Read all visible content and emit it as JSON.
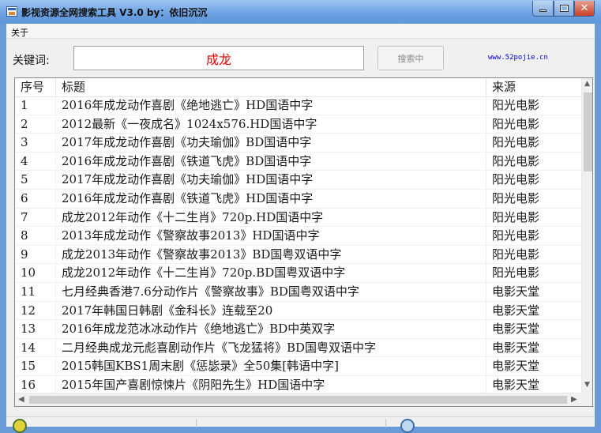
{
  "window": {
    "title": "影视资源全网搜索工具 V3.0 by：依旧沉沉",
    "close_glyph": "✕"
  },
  "menu": {
    "about": "关于"
  },
  "search": {
    "label": "关键词:",
    "value": "成龙",
    "button_label": "搜索中",
    "site": "www.52pojie.cn"
  },
  "colors": {
    "keyword_text": "#e60000",
    "link": "#0000cc",
    "titlebar": "#6ea3e3"
  },
  "table": {
    "columns": [
      "序号",
      "标题",
      "来源"
    ],
    "rows": [
      [
        "1",
        "2016年成龙动作喜剧《绝地逃亡》HD国语中字",
        "阳光电影"
      ],
      [
        "2",
        "2012最新《一夜成名》1024x576.HD国语中字",
        "阳光电影"
      ],
      [
        "3",
        "2017年成龙动作喜剧《功夫瑜伽》BD国语中字",
        "阳光电影"
      ],
      [
        "4",
        "2016年成龙动作喜剧《铁道飞虎》BD国语中字",
        "阳光电影"
      ],
      [
        "5",
        "2017年成龙动作喜剧《功夫瑜伽》HD国语中字",
        "阳光电影"
      ],
      [
        "6",
        "2016年成龙动作喜剧《铁道飞虎》HD国语中字",
        "阳光电影"
      ],
      [
        "7",
        "成龙2012年动作《十二生肖》720p.HD国语中字",
        "阳光电影"
      ],
      [
        "8",
        "2013年成龙动作《警察故事2013》HD国语中字",
        "阳光电影"
      ],
      [
        "9",
        "成龙2013年动作《警察故事2013》BD国粤双语中字",
        "阳光电影"
      ],
      [
        "10",
        "成龙2012年动作《十二生肖》720p.BD国粤双语中字",
        "阳光电影"
      ],
      [
        "11",
        "七月经典香港7.6分动作片《警察故事》BD国粤双语中字",
        "电影天堂"
      ],
      [
        "12",
        "2017年韩国日韩剧《金科长》连载至20",
        "电影天堂"
      ],
      [
        "13",
        "2016年成龙范冰冰动作片《绝地逃亡》BD中英双字",
        "电影天堂"
      ],
      [
        "14",
        "二月经典成龙元彪喜剧动作片《飞龙猛将》BD国粤双语中字",
        "电影天堂"
      ],
      [
        "15",
        "2015韩国KBS1周末剧《惩毖录》全50集[韩语中字]",
        "电影天堂"
      ],
      [
        "16",
        "2015年国产喜剧惊悚片《阴阳先生》HD国语中字",
        "电影天堂"
      ]
    ]
  }
}
